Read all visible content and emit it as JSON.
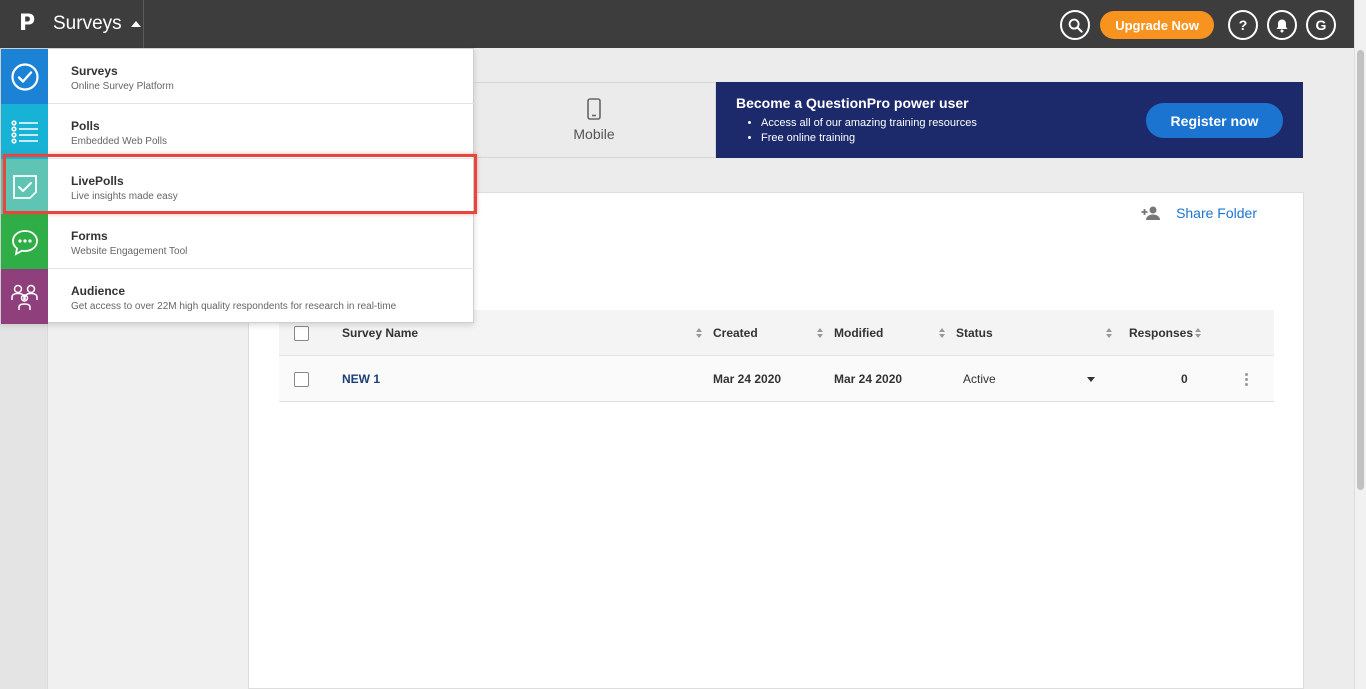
{
  "topbar": {
    "logo": "P",
    "app_name": "Surveys",
    "upgrade_label": "Upgrade Now",
    "help_label": "?",
    "avatar_letter": "G"
  },
  "create": {
    "mobile_label": "Mobile"
  },
  "promo": {
    "title": "Become a QuestionPro power user",
    "bullets": [
      "Access all of our amazing training resources",
      "Free online training"
    ],
    "register_label": "Register now"
  },
  "panel": {
    "share_label": "Share Folder"
  },
  "table": {
    "columns": [
      "Survey Name",
      "Created",
      "Modified",
      "Status",
      "Responses"
    ],
    "rows": [
      {
        "name": "NEW 1",
        "created": "Mar 24 2020",
        "modified": "Mar 24 2020",
        "status": "Active",
        "responses": "0"
      }
    ]
  },
  "menu": {
    "items": [
      {
        "title": "Surveys",
        "subtitle": "Online Survey Platform",
        "color": "#1b82d6",
        "icon": "check-circle-icon"
      },
      {
        "title": "Polls",
        "subtitle": "Embedded Web Polls",
        "color": "#16b3d6",
        "icon": "list-icon"
      },
      {
        "title": "LivePolls",
        "subtitle": "Live insights made easy",
        "color": "#5fc4b4",
        "icon": "checkbox-check-icon"
      },
      {
        "title": "Forms",
        "subtitle": "Website Engagement Tool",
        "color": "#2fae47",
        "icon": "chat-bubble-icon"
      },
      {
        "title": "Audience",
        "subtitle": "Get access to over 22M high quality respondents for research in real-time",
        "color": "#8e3f7c",
        "icon": "people-icon"
      }
    ]
  },
  "colors": {
    "topbar": "#3d3d3d",
    "accent_orange": "#f7931e",
    "promo_bg": "#1c2a6b",
    "primary_blue": "#1b75d0",
    "highlight_red": "#e5473d"
  }
}
